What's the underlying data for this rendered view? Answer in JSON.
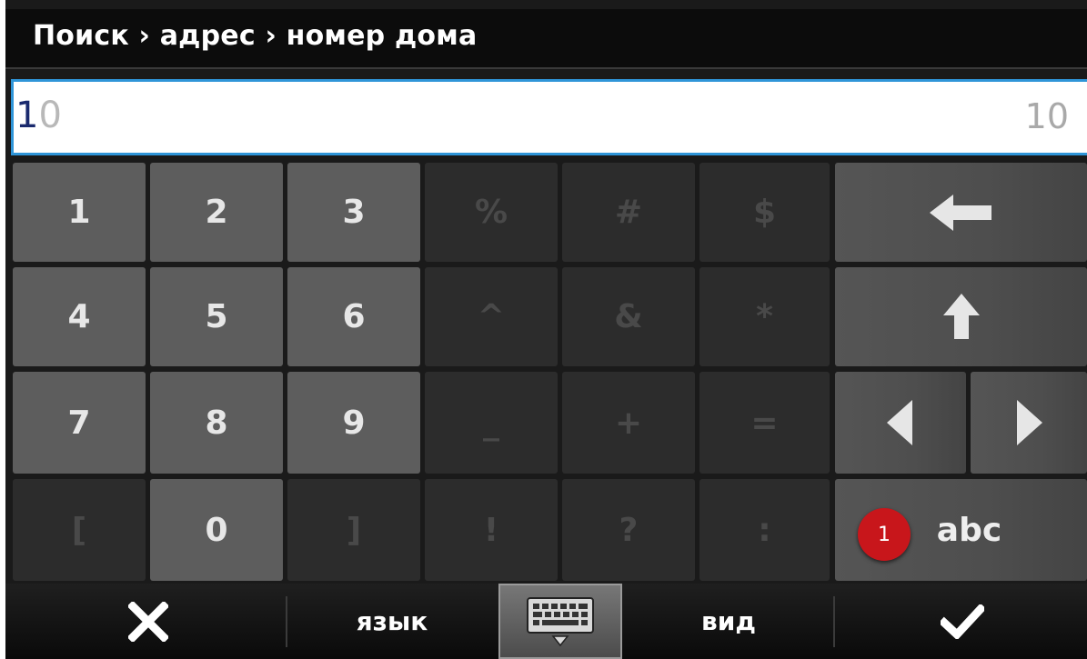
{
  "header": {
    "title": "Поиск › адрес › номер дома"
  },
  "input": {
    "typed": "1",
    "ghost_completion": "0",
    "suggestion": "10"
  },
  "keypad": {
    "row1": [
      "1",
      "2",
      "3",
      "%",
      "#",
      "$"
    ],
    "row2": [
      "4",
      "5",
      "6",
      "^",
      "&",
      "*"
    ],
    "row3": [
      "7",
      "8",
      "9",
      "_",
      "+",
      "="
    ],
    "row4": [
      "[",
      "0",
      "]",
      "!",
      "?",
      ":"
    ]
  },
  "controls": {
    "backspace_icon": "arrow-left-icon",
    "shift_icon": "arrow-up-icon",
    "cursor_left_icon": "triangle-left-icon",
    "cursor_right_icon": "triangle-right-icon",
    "abc_label": "abc",
    "abc_badge": "1"
  },
  "bottom_bar": {
    "cancel_icon": "close-icon",
    "language_label": "язык",
    "keyboard_icon": "keyboard-icon",
    "view_label": "вид",
    "confirm_icon": "checkmark-icon"
  },
  "colors": {
    "accent": "#2f95d8",
    "badge": "#c8161b",
    "num_key": "#5d5d5d",
    "sym_key": "#2c2c2c"
  }
}
